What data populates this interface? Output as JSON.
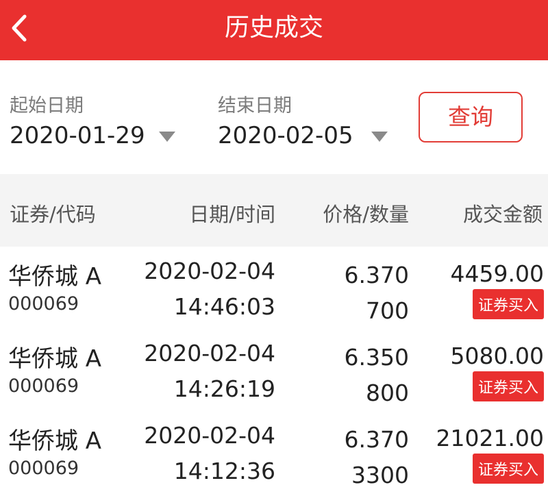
{
  "header": {
    "title": "历史成交"
  },
  "filter": {
    "start_label": "起始日期",
    "start_value": "2020-01-29",
    "end_label": "结束日期",
    "end_value": "2020-02-05",
    "query_label": "查询"
  },
  "table": {
    "columns": [
      "证券/代码",
      "日期/时间",
      "价格/数量",
      "成交金额"
    ],
    "rows": [
      {
        "name": "华侨城 A",
        "code": "000069",
        "date": "2020-02-04",
        "time": "14:46:03",
        "price": "6.370",
        "qty": "700",
        "amount": "4459.00",
        "type": "证券买入"
      },
      {
        "name": "华侨城 A",
        "code": "000069",
        "date": "2020-02-04",
        "time": "14:26:19",
        "price": "6.350",
        "qty": "800",
        "amount": "5080.00",
        "type": "证券买入"
      },
      {
        "name": "华侨城 A",
        "code": "000069",
        "date": "2020-02-04",
        "time": "14:12:36",
        "price": "6.370",
        "qty": "3300",
        "amount": "21021.00",
        "type": "证券买入"
      }
    ]
  },
  "colors": {
    "header_bg": "#e9302f",
    "accent": "#e23c36"
  }
}
